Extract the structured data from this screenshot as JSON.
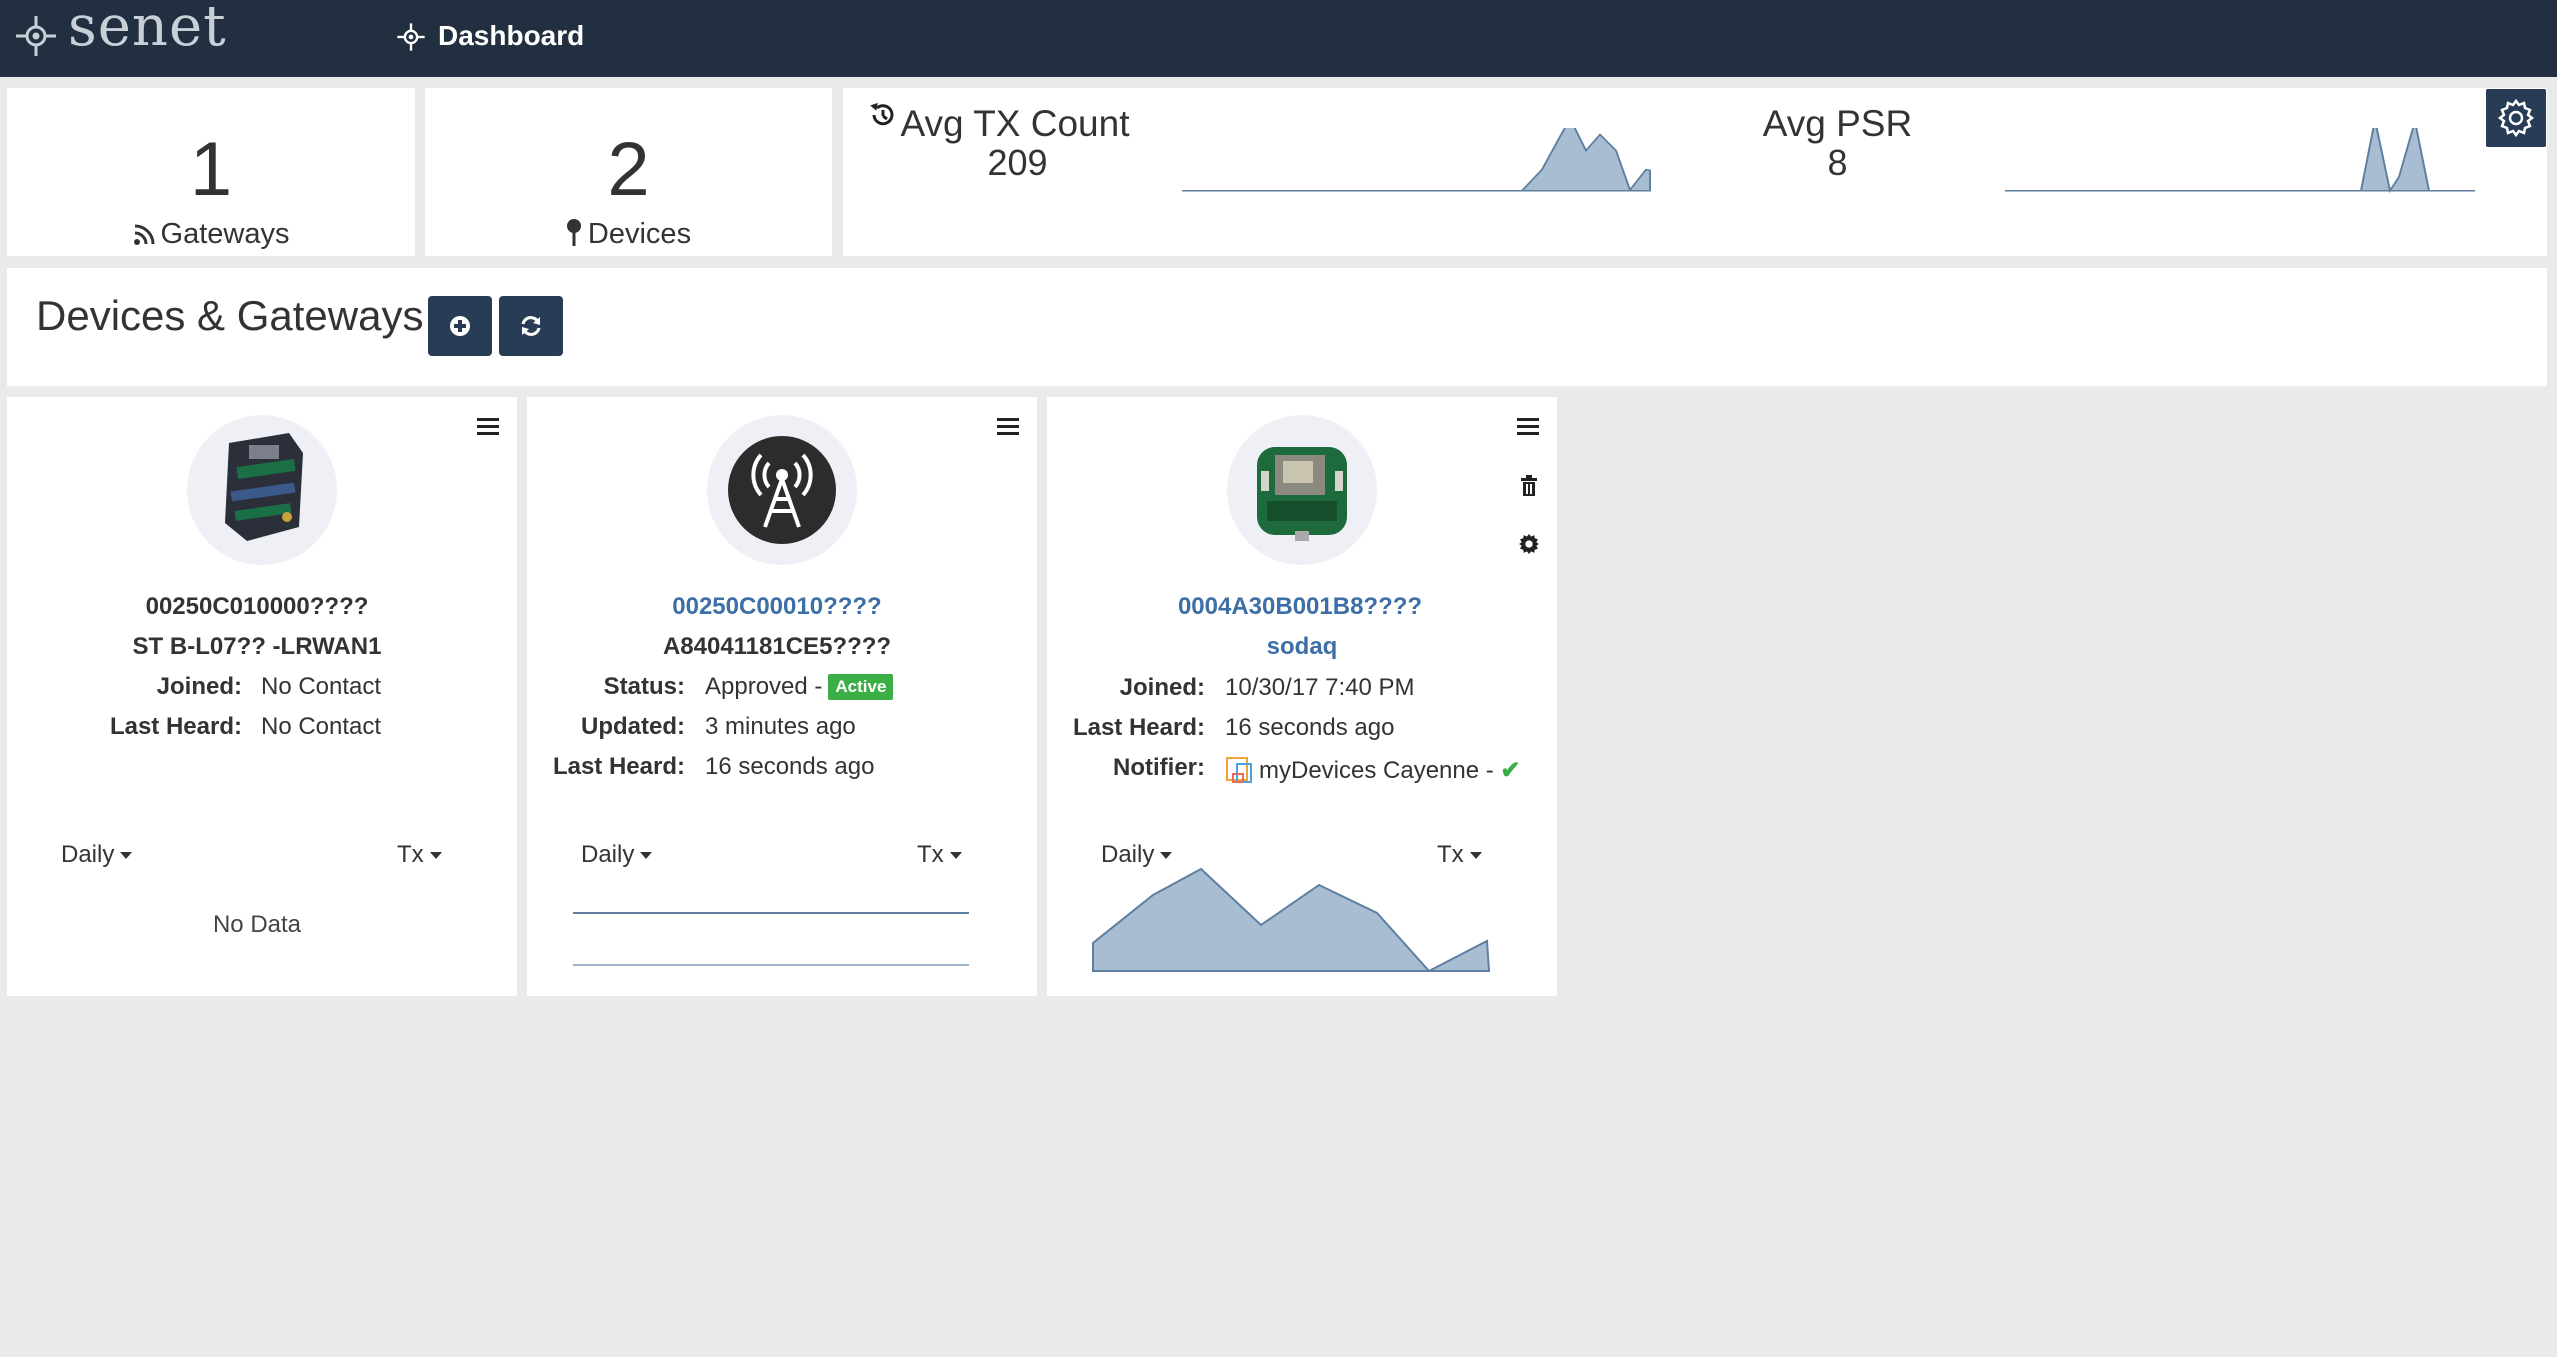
{
  "app": {
    "logo_text": "senet",
    "nav_label": "Dashboard",
    "logo_icon": "crosshair-gear-icon",
    "nav_icon": "dashboard-icon"
  },
  "stats": {
    "gateways": {
      "count": "1",
      "label": "Gateways",
      "icon": "rss-icon"
    },
    "devices": {
      "count": "2",
      "label": "Devices",
      "icon": "map-pin-icon"
    }
  },
  "metrics": {
    "tx": {
      "title": "Avg TX Count",
      "value": "209",
      "icon": "history-icon"
    },
    "psr": {
      "title": "Avg PSR",
      "value": "8"
    },
    "settings_icon": "gear-icon"
  },
  "section": {
    "title": "Devices & Gateways",
    "add_icon": "plus-circle-icon",
    "refresh_icon": "refresh-icon"
  },
  "cards": [
    {
      "id": "00250C010000????",
      "name": "ST B-L07?? -LRWAN1",
      "fields": [
        {
          "key": "Joined:",
          "value": "No Contact"
        },
        {
          "key": "Last Heard:",
          "value": "No Contact"
        }
      ],
      "period": "Daily",
      "metric": "Tx",
      "no_data": "No Data",
      "menu_icon": "hamburger-icon"
    },
    {
      "id": "00250C00010????",
      "name": "A84041181CE5????",
      "fields": [
        {
          "key": "Status:",
          "value": "Approved -",
          "badge": "Active"
        },
        {
          "key": "Updated:",
          "value": "3 minutes ago"
        },
        {
          "key": "Last Heard:",
          "value": "16 seconds ago"
        }
      ],
      "period": "Daily",
      "metric": "Tx",
      "menu_icon": "hamburger-icon"
    },
    {
      "id": "0004A30B001B8????",
      "name": "sodaq",
      "fields": [
        {
          "key": "Joined:",
          "value": "10/30/17 7:40 PM"
        },
        {
          "key": "Last Heard:",
          "value": "16 seconds ago"
        },
        {
          "key": "Notifier:",
          "value": "myDevices Cayenne -"
        }
      ],
      "period": "Daily",
      "metric": "Tx",
      "menu_icon": "hamburger-icon",
      "delete_icon": "trash-icon",
      "settings_icon": "gear-icon",
      "notifier_icon": "cayenne-icon",
      "check_icon": "check-icon"
    }
  ],
  "colors": {
    "topbar": "#222f40",
    "button": "#293c55",
    "link": "#3c6fa6",
    "chart_fill": "#a9bdd2",
    "chart_line": "#5f7fa1",
    "active": "#3bae45",
    "background": "#e9eaea"
  }
}
